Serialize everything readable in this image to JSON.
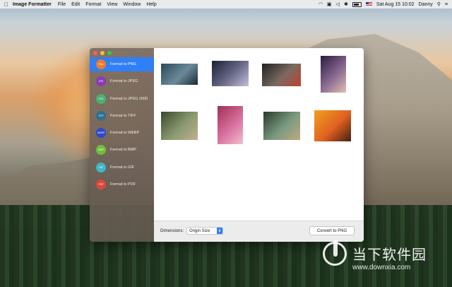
{
  "menubar": {
    "app_name": "Image Formatter",
    "menus": [
      "File",
      "Edit",
      "Format",
      "View",
      "Window",
      "Help"
    ],
    "datetime": "Sat Aug 15  10:02",
    "user": "Danny"
  },
  "sidebar": {
    "items": [
      {
        "label": "Format to PNG",
        "icon": "PNG",
        "color": "#f07a30",
        "active": true
      },
      {
        "label": "Format to JPEG",
        "icon": "JPG",
        "color": "#8b3ab8",
        "active": false
      },
      {
        "label": "Format to JPEG 2000",
        "icon": "JPG",
        "color": "#4caf74",
        "active": false
      },
      {
        "label": "Format to TIFF",
        "icon": "TIFF",
        "color": "#2f6f8f",
        "active": false
      },
      {
        "label": "Format to WEBP",
        "icon": "WEBP",
        "color": "#2c49c8",
        "active": false
      },
      {
        "label": "Format to BMP",
        "icon": "BMP",
        "color": "#6fbf3a",
        "active": false
      },
      {
        "label": "Format to GIF",
        "icon": "GIF",
        "color": "#3fb8c8",
        "active": false
      },
      {
        "label": "Format to PDF",
        "icon": "PDF",
        "color": "#d84a3a",
        "active": false
      }
    ]
  },
  "thumbnails": [
    {
      "name": "thumb-car",
      "colors": [
        "#2a4a5a",
        "#6a8a9a",
        "#1a2a30"
      ]
    },
    {
      "name": "thumb-motorcycle",
      "colors": [
        "#1a2030",
        "#6a6a8a",
        "#c8c0d8"
      ]
    },
    {
      "name": "thumb-sportscar",
      "colors": [
        "#202020",
        "#7a6a60",
        "#c04030"
      ]
    },
    {
      "name": "thumb-portrait",
      "colors": [
        "#2a1a40",
        "#8a6a90",
        "#e0c0b0"
      ]
    },
    {
      "name": "thumb-forest-girl",
      "colors": [
        "#3a4a2a",
        "#8a9a70",
        "#c0b090"
      ]
    },
    {
      "name": "thumb-pink-dress",
      "colors": [
        "#a03050",
        "#d870a0",
        "#f0c0d0"
      ]
    },
    {
      "name": "thumb-forest-girl-2",
      "colors": [
        "#2a3a2a",
        "#7a9a80",
        "#c0a880"
      ]
    },
    {
      "name": "thumb-sunset-girl",
      "colors": [
        "#f0a020",
        "#e06020",
        "#402010"
      ]
    }
  ],
  "bottom_bar": {
    "dimensions_label": "Dimensions:",
    "dimensions_value": "Origin Size",
    "convert_label": "Convert to PNG"
  },
  "watermark": {
    "cn_text": "当下软件园",
    "url": "www.downxia.com"
  }
}
